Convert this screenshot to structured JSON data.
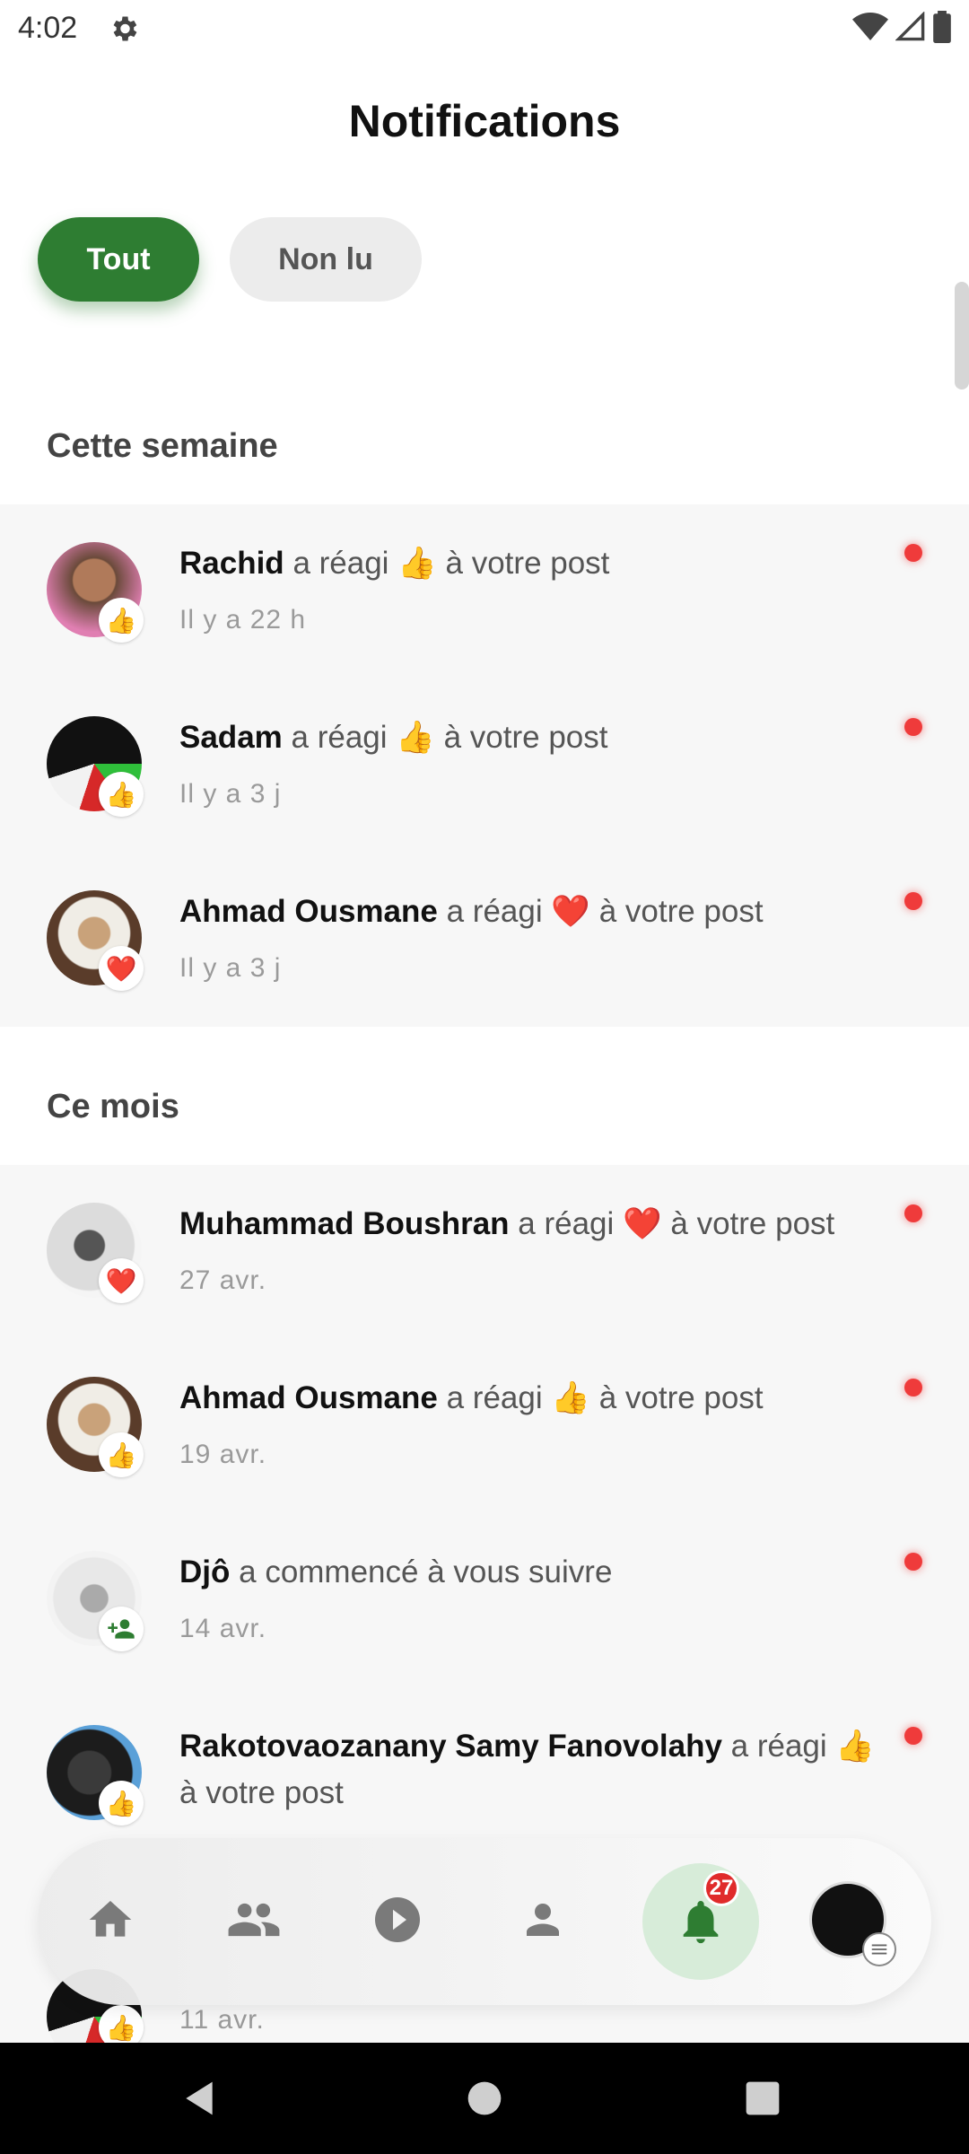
{
  "status_bar": {
    "time": "4:02"
  },
  "header": {
    "title": "Notifications"
  },
  "filters": {
    "all": "Tout",
    "unread": "Non lu"
  },
  "sections": {
    "this_week": "Cette semaine",
    "this_month": "Ce mois"
  },
  "notifications": [
    {
      "name": "Rachid",
      "action": "a réagi",
      "emoji": "👍",
      "suffix": "à votre post",
      "time": "Il y a 22 h"
    },
    {
      "name": "Sadam",
      "action": "a réagi",
      "emoji": "👍",
      "suffix": "à votre post",
      "time": "Il y a 3 j"
    },
    {
      "name": "Ahmad Ousmane",
      "action": "a réagi",
      "emoji": "❤️",
      "suffix": "à votre post",
      "time": "Il y a 3 j"
    },
    {
      "name": "Muhammad Boushran",
      "action": "a réagi",
      "emoji": "❤️",
      "suffix": "à votre post",
      "time": "27 avr."
    },
    {
      "name": "Ahmad Ousmane",
      "action": "a réagi",
      "emoji": "👍",
      "suffix": "à votre post",
      "time": "19 avr."
    },
    {
      "name": "Djô",
      "action": "a commencé à vous suivre",
      "emoji": "",
      "suffix": "",
      "time": "14 avr."
    },
    {
      "name": "Rakotovaozanany Samy Fanovolahy",
      "action": "a réagi",
      "emoji": "👍",
      "suffix": "à votre post",
      "time": ""
    },
    {
      "name": "",
      "action": "",
      "emoji": "",
      "suffix": "",
      "time": "11 avr."
    }
  ],
  "bottom_nav": {
    "notification_count": "27"
  },
  "colors": {
    "accent": "#2e7d32",
    "unread_dot": "#ef3b3b",
    "badge": "#e02b2b"
  }
}
